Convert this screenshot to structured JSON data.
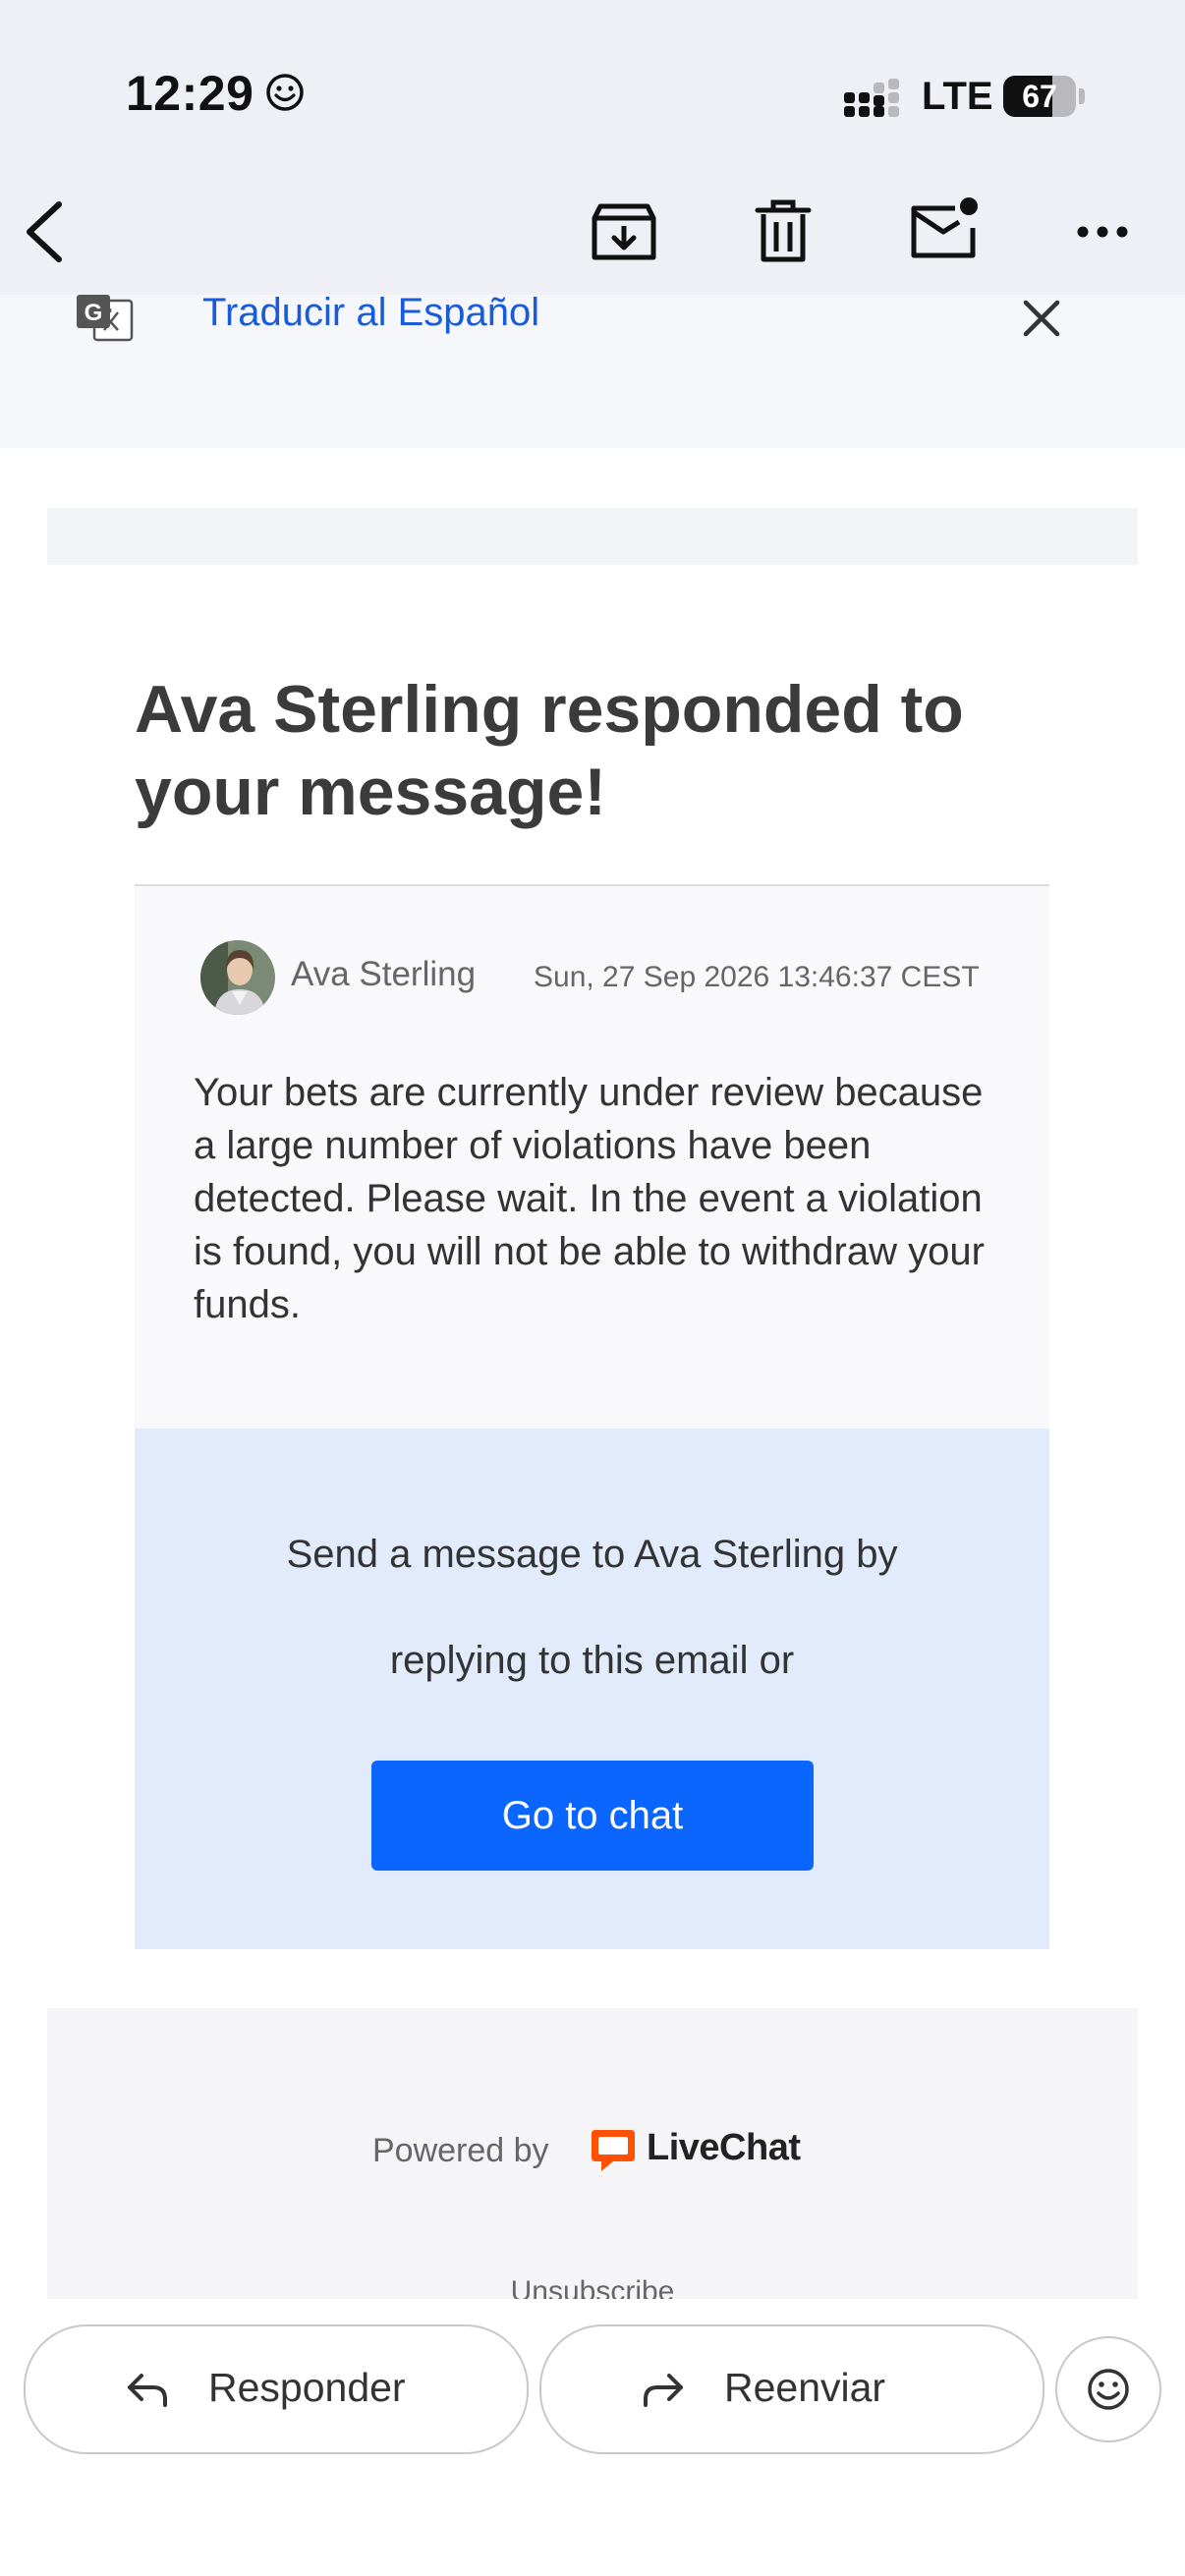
{
  "status_bar": {
    "time": "12:29",
    "network": "LTE",
    "battery": "67",
    "battery_level": 0.67
  },
  "toolbar": {
    "icons": [
      "back-arrow-icon",
      "archive-icon",
      "delete-icon",
      "mark-unread-icon",
      "more-options-icon"
    ]
  },
  "translate_banner": {
    "link_text": "Traducir al Español"
  },
  "email": {
    "headline": "Ava Sterling responded to your message!",
    "message": {
      "sender": "Ava Sterling",
      "date": "Sun, 27 Sep 2026 13:46:37 CEST",
      "body": "Your bets are currently under review because a large number of violations have been detected. Please wait. In the event a violation is found, you will not be able to withdraw your funds."
    },
    "reply": {
      "line1": "Send a message to Ava Sterling by",
      "line2": "replying to this email or",
      "button": "Go to chat"
    },
    "footer": {
      "powered_by": "Powered by",
      "brand": "LiveChat",
      "unsubscribe": "Unsubscribe"
    }
  },
  "actions": {
    "reply": "Responder",
    "forward": "Reenviar"
  },
  "colors": {
    "link_blue": "#1a5bd8",
    "chat_button": "#0a66ff",
    "reply_panel": "#e1ebfc",
    "livechat_orange": "#ff5100"
  }
}
